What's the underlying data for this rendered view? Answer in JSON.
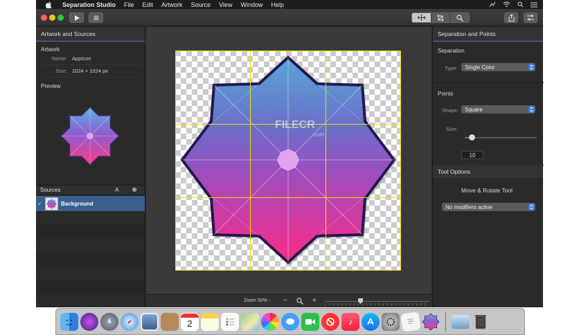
{
  "menubar": {
    "app_name": "Separation Studio",
    "menus": [
      "File",
      "Edit",
      "Artwork",
      "Source",
      "View",
      "Window",
      "Help"
    ]
  },
  "left_panel": {
    "header": "Artwork and Sources",
    "artwork_section": "Artwork",
    "name_label": "Name:",
    "name_value": "AppIcon",
    "size_label": "Size:",
    "size_value": "1024 × 1024 px",
    "preview_label": "Preview",
    "sources_label": "Sources",
    "sources_a_button": "A",
    "source_items": [
      {
        "name": "Background",
        "checked": true
      }
    ]
  },
  "canvas": {
    "watermark": "FILECR",
    "watermark_sub": ".com"
  },
  "zoom_bar": {
    "zoom_label": "Zoom 50% ◦",
    "minus": "−",
    "plus": "+",
    "zoom_percent": 50
  },
  "right_panel": {
    "header": "Separation and Points",
    "separation_label": "Separation",
    "type_label": "Type:",
    "type_value": "Single Color",
    "points_label": "Points",
    "shape_label": "Shape:",
    "shape_value": "Square",
    "size_label": "Size:",
    "size_value": "10",
    "tool_options_header": "Tool Options",
    "tool_name": "Move & Rotate Tool",
    "modifiers_value": "No modifiers active"
  },
  "colors": {
    "accent": "#3a7ae0",
    "selection": "#3a5f8d",
    "guide": "#e8e000",
    "star_top": "#5aa0d8",
    "star_bottom": "#ff2d8a",
    "star_outline": "#2a1a5a"
  },
  "dock": {
    "apps": [
      "finder-icon",
      "siri-icon",
      "launchpad-icon",
      "safari-icon",
      "preview-photo-icon",
      "notefile-icon",
      "calendar-icon",
      "notes-icon",
      "reminders-icon",
      "maps-icon",
      "photos-icon",
      "messages-icon",
      "facetime-icon",
      "news-icon",
      "music-icon",
      "app-store-icon",
      "system-preferences-icon",
      "textedit-icon",
      "separation-studio-icon",
      "downloads-folder-icon",
      "trash-icon"
    ],
    "calendar_day": "2"
  }
}
